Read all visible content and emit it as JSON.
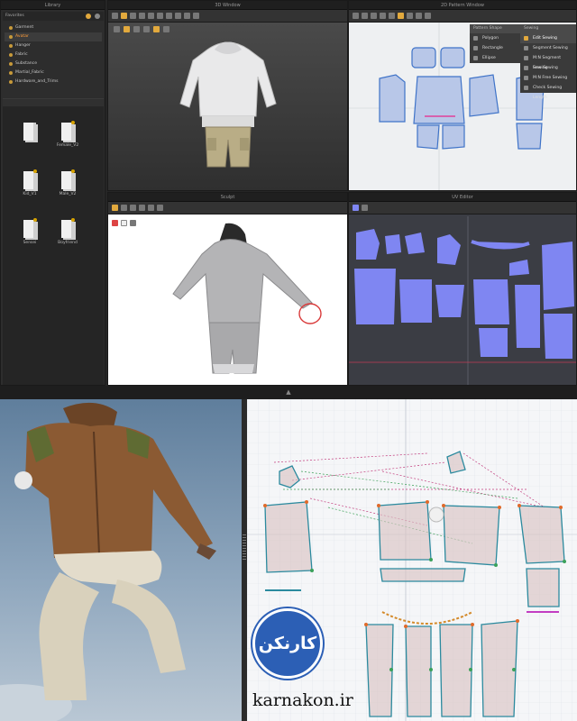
{
  "library": {
    "title": "Library",
    "favorites_label": "Favorites",
    "tree": [
      "Garment",
      "Avatar",
      "Hanger",
      "Fabric",
      "Substance",
      "Martial_Fabric",
      "Hardware_and_Trims"
    ],
    "files": [
      "",
      "Female_V2",
      "Kid_V1",
      "Male_V2",
      "Sensei",
      "Boyfriend"
    ]
  },
  "window3d": {
    "title": "3D Window"
  },
  "pattern2d": {
    "title": "2D Pattern Window"
  },
  "scroll_panel": {
    "title": "Sculpt"
  },
  "uv_panel": {
    "title": "UV Editor"
  },
  "dropdowns": {
    "shape_header": "Pattern Shape",
    "shape_items": [
      "Polygon",
      "Rectangle",
      "Ellipse"
    ],
    "sewing_header": "Sewing",
    "sewing_items": [
      "Edit Sewing",
      "Segment Sewing",
      "M:N Segment Sewing",
      "Free Sewing",
      "M:N Free Sewing",
      "Check Sewing Length"
    ]
  },
  "logo": {
    "text": "کارنکن"
  },
  "watermark": {
    "text": "karnakon.ir"
  },
  "colors": {
    "accent": "#e2a93d",
    "uv_blue": "#7f86f2",
    "logo_blue": "#2c5fb5"
  }
}
